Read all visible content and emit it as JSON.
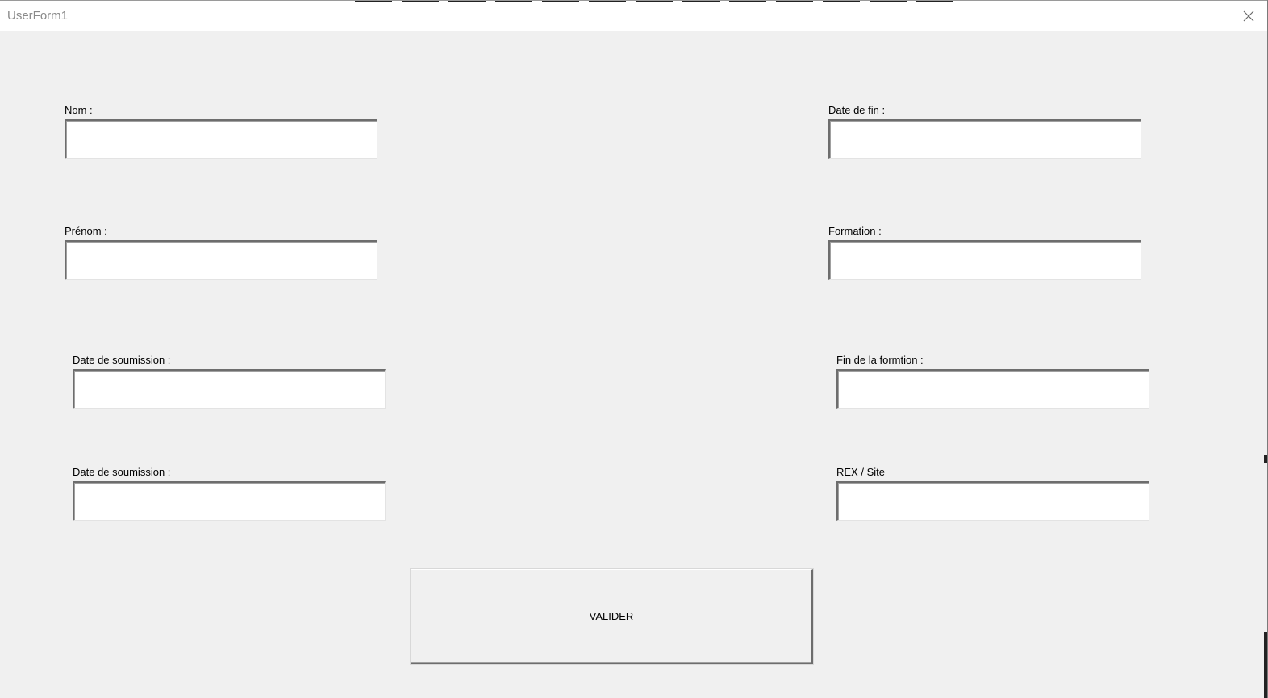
{
  "window": {
    "title": "UserForm1"
  },
  "icons": {
    "close": "close-icon"
  },
  "fields": {
    "nom": {
      "label": "Nom :",
      "value": ""
    },
    "prenom": {
      "label": "Prénom :",
      "value": ""
    },
    "date_soumission_1": {
      "label": "Date de soumission :",
      "value": ""
    },
    "date_soumission_2": {
      "label": "Date de soumission :",
      "value": ""
    },
    "date_fin": {
      "label": "Date de fin :",
      "value": ""
    },
    "formation": {
      "label": "Formation :",
      "value": ""
    },
    "fin_formation": {
      "label": "Fin de la formtion :",
      "value": ""
    },
    "rex_site": {
      "label": "REX / Site",
      "value": ""
    }
  },
  "actions": {
    "submit_label": "VALIDER"
  }
}
